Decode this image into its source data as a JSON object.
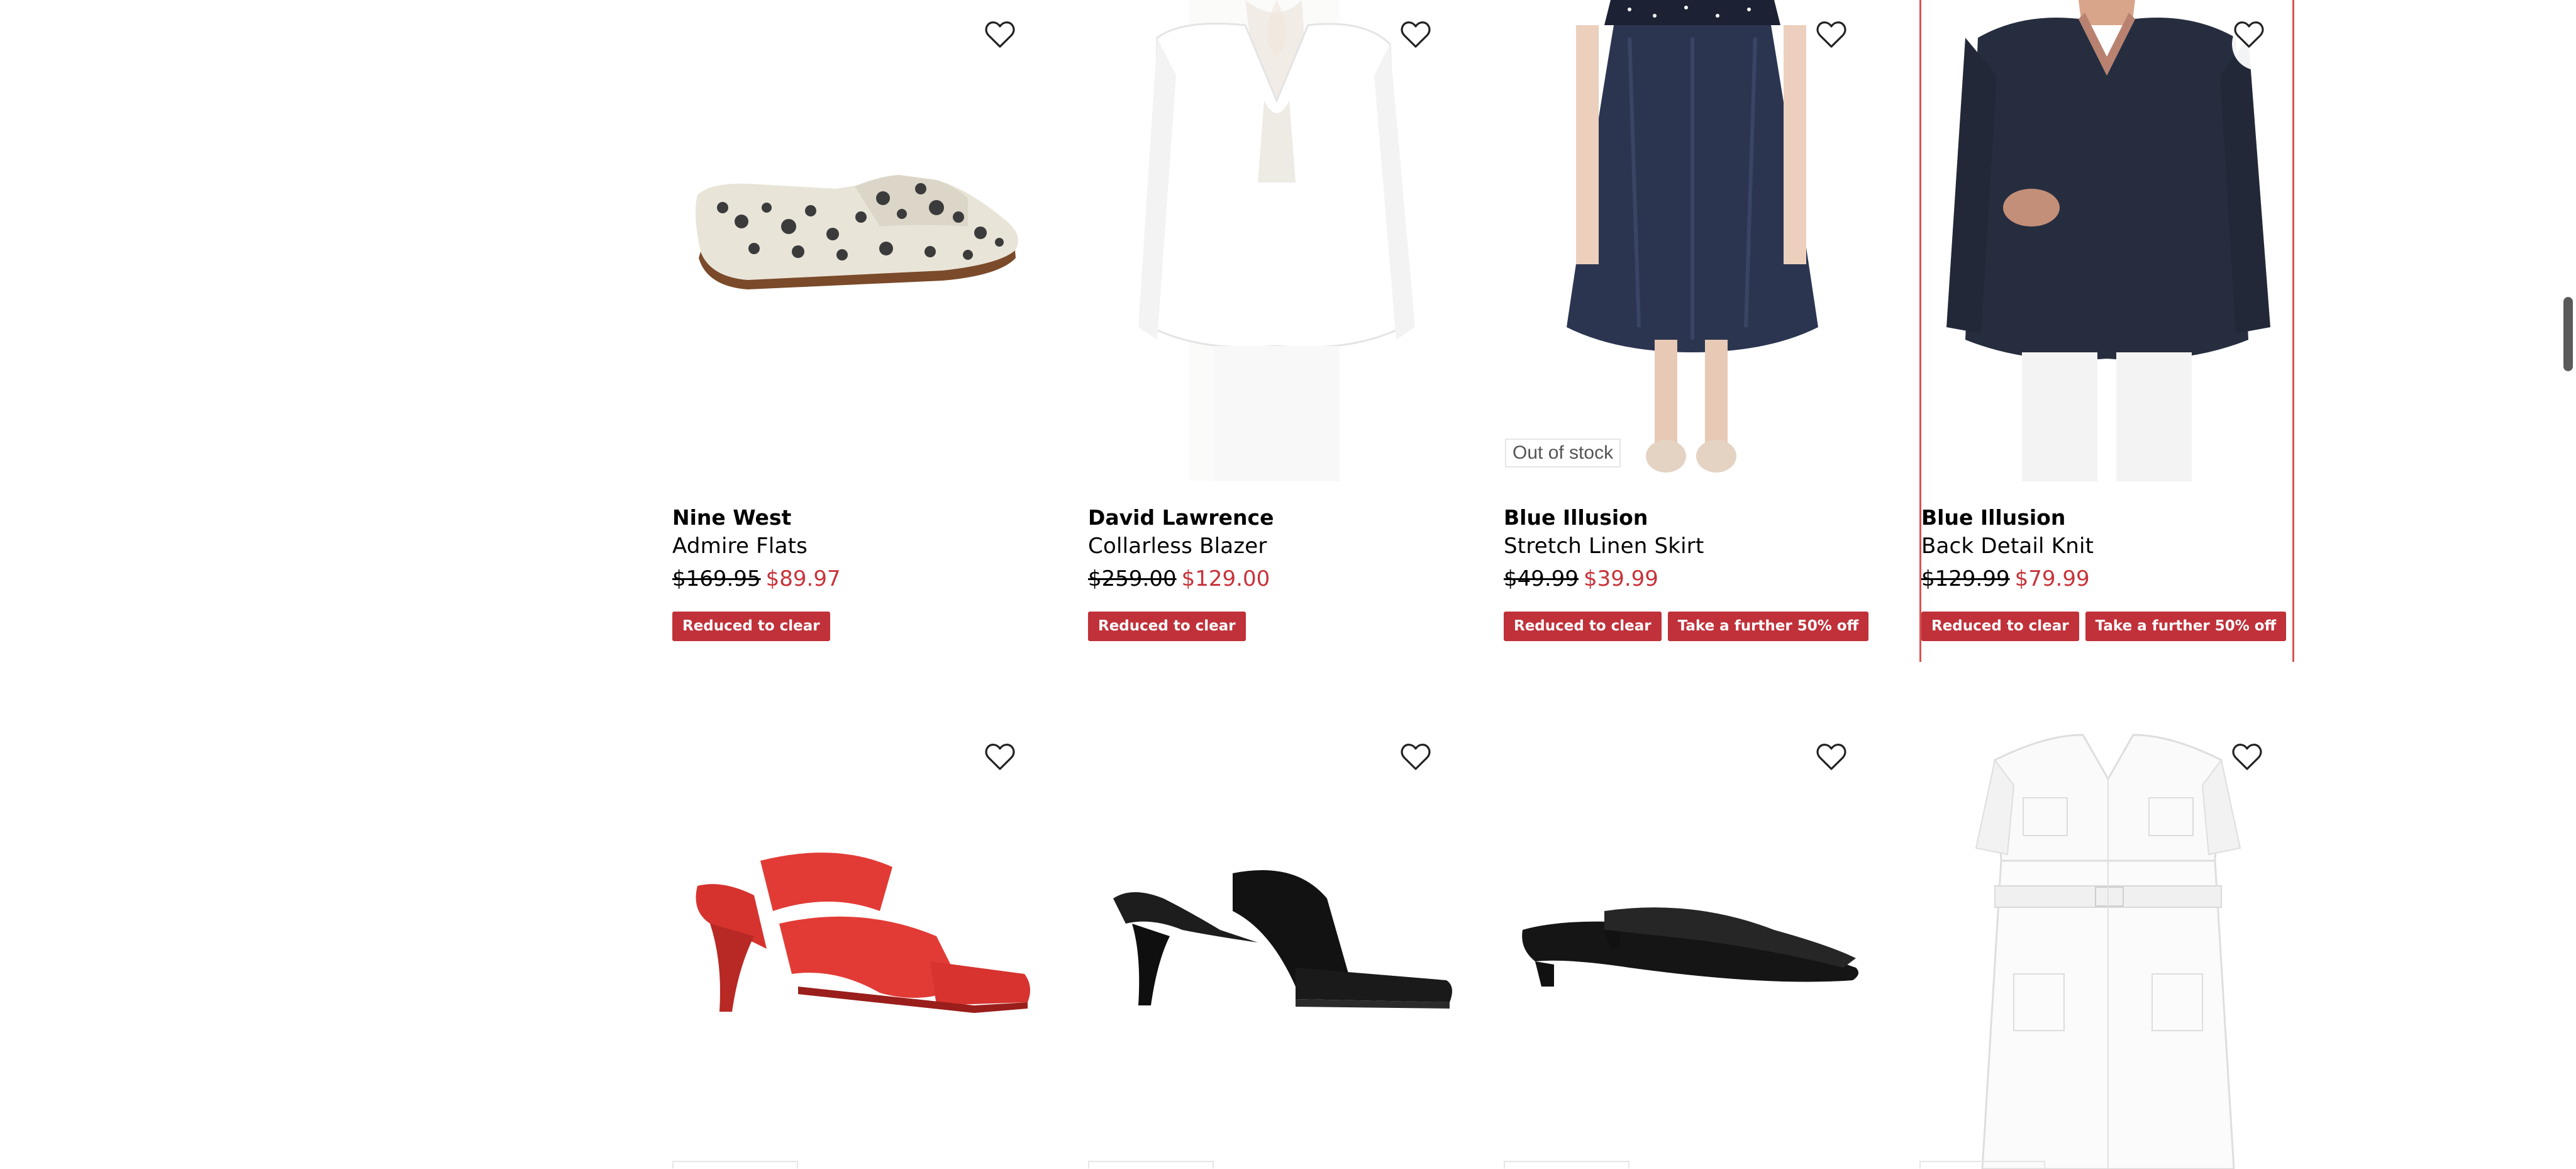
{
  "products": [
    {
      "brand": "Nine West",
      "name": "Admire Flats",
      "price_was": "$169.95",
      "price_now": "$89.97",
      "tags": [
        "Reduced to clear"
      ],
      "stock_badge": ""
    },
    {
      "brand": "David Lawrence",
      "name": "Collarless Blazer",
      "price_was": "$259.00",
      "price_now": "$129.00",
      "tags": [
        "Reduced to clear"
      ],
      "stock_badge": ""
    },
    {
      "brand": "Blue Illusion",
      "name": "Stretch Linen Skirt",
      "price_was": "$49.99",
      "price_now": "$39.99",
      "tags": [
        "Reduced to clear",
        "Take a further 50% off"
      ],
      "stock_badge": "Out of stock"
    },
    {
      "brand": "Blue Illusion",
      "name": "Back Detail Knit",
      "price_was": "$129.99",
      "price_now": "$79.99",
      "tags": [
        "Reduced to clear",
        "Take a further 50% off"
      ],
      "stock_badge": ""
    }
  ],
  "row2": [
    {
      "image": "red-square-toe-mule-heel"
    },
    {
      "image": "black-toe-post-mule-heel"
    },
    {
      "image": "black-pointed-kitten-mule"
    },
    {
      "image": "white-linen-belted-dress"
    }
  ],
  "icons": {
    "wishlist": "heart-outline-icon"
  },
  "colors": {
    "sale_red": "#c0313a",
    "price_red": "#c8333a",
    "selected_border": "#d9534f"
  }
}
